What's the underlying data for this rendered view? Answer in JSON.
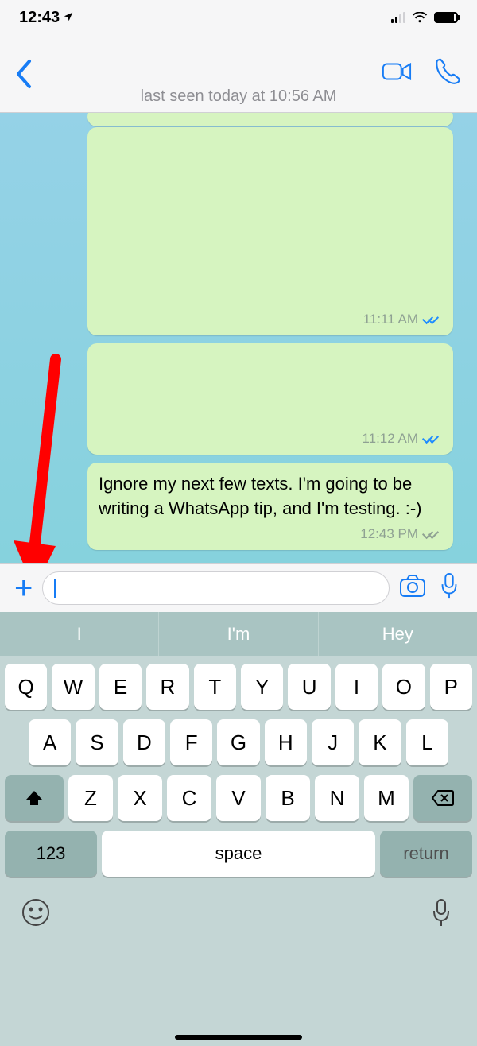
{
  "status": {
    "time": "12:43"
  },
  "header": {
    "subtitle": "last seen today at 10:56 AM"
  },
  "messages": [
    {
      "time": "11:11 AM",
      "read": true,
      "text": ""
    },
    {
      "time": "11:12 AM",
      "read": true,
      "text": ""
    },
    {
      "time": "12:43 PM",
      "read": false,
      "text": "Ignore my next few texts. I'm going to be writing a WhatsApp tip, and I'm testing. :-)"
    }
  ],
  "suggestions": [
    "I",
    "I'm",
    "Hey"
  ],
  "keyboard": {
    "row1": [
      "Q",
      "W",
      "E",
      "R",
      "T",
      "Y",
      "U",
      "I",
      "O",
      "P"
    ],
    "row2": [
      "A",
      "S",
      "D",
      "F",
      "G",
      "H",
      "J",
      "K",
      "L"
    ],
    "row3": [
      "Z",
      "X",
      "C",
      "V",
      "B",
      "N",
      "M"
    ],
    "numKey": "123",
    "space": "space",
    "return": "return"
  }
}
